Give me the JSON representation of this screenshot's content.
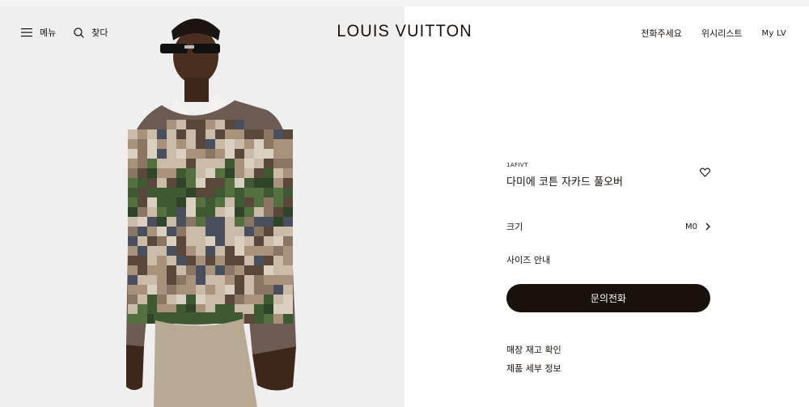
{
  "header": {
    "menu_label": "메뉴",
    "search_label": "찾다",
    "logo": "LOUIS VUITTON",
    "call_label": "전화주세요",
    "wishlist_label": "위시리스트",
    "account_label": "My LV"
  },
  "product": {
    "sku": "1AFIVT",
    "name": "다미에 코튼 자카드 풀오버",
    "size_label": "크기",
    "size_value": "M0",
    "size_guide": "사이즈 안내",
    "cta_label": "문의전화",
    "store_stock": "매장 재고 확인",
    "details": "제품 세부 정보"
  },
  "colors": {
    "brand_dark": "#19110b",
    "image_bg": "#efefef"
  }
}
